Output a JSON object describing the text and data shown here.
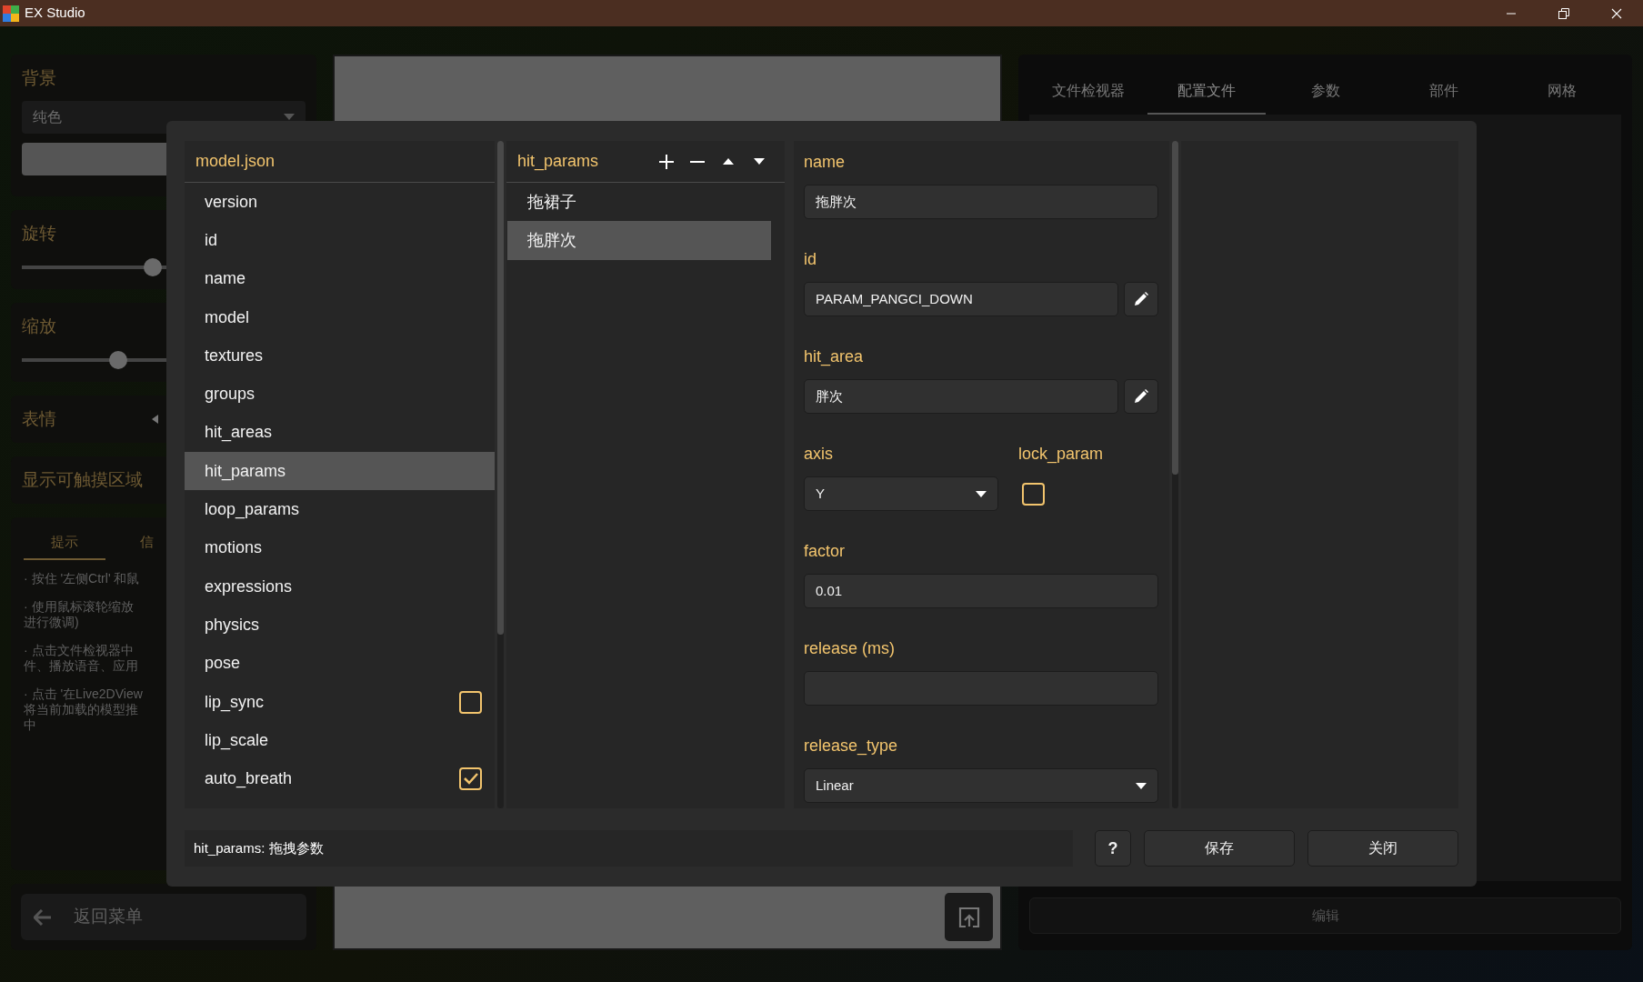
{
  "window": {
    "title": "EX Studio"
  },
  "sidebar": {
    "background": {
      "label": "背景",
      "value": "纯色"
    },
    "rotation": {
      "label": "旋转",
      "level": 0.46
    },
    "scale": {
      "label": "缩放",
      "level": 0.34
    },
    "expressions": {
      "label": "表情",
      "expanded": false
    },
    "touch_areas": {
      "label": "显示可触摸区域"
    },
    "hints": {
      "tabs": [
        {
          "label": "提示",
          "selected": true
        },
        {
          "label": "信",
          "selected": false
        }
      ],
      "items": [
        [
          "· 按住 '左侧Ctrl' 和鼠"
        ],
        [
          "· 使用鼠标滚轮缩放",
          "进行微调)"
        ],
        [
          "· 点击文件检视器中",
          "件、播放语音、应用"
        ],
        [
          "· 点击 '在Live2DView",
          "将当前加载的模型推",
          "中"
        ]
      ]
    },
    "back_button": "返回菜单"
  },
  "right_panel": {
    "tabs": [
      {
        "label": "文件检视器",
        "selected": false
      },
      {
        "label": "配置文件",
        "selected": true
      },
      {
        "label": "参数",
        "selected": false
      },
      {
        "label": "部件",
        "selected": false
      },
      {
        "label": "网格",
        "selected": false
      }
    ],
    "button": "编辑"
  },
  "dialog": {
    "tree": {
      "title": "model.json",
      "items": [
        {
          "label": "version",
          "kind": "item",
          "selected": false
        },
        {
          "label": "id",
          "kind": "item",
          "selected": false
        },
        {
          "label": "name",
          "kind": "item",
          "selected": false
        },
        {
          "label": "model",
          "kind": "item",
          "selected": false
        },
        {
          "label": "textures",
          "kind": "item",
          "selected": false
        },
        {
          "label": "groups",
          "kind": "item",
          "selected": false
        },
        {
          "label": "hit_areas",
          "kind": "item",
          "selected": false
        },
        {
          "label": "hit_params",
          "kind": "item",
          "selected": true
        },
        {
          "label": "loop_params",
          "kind": "item",
          "selected": false
        },
        {
          "label": "motions",
          "kind": "item",
          "selected": false
        },
        {
          "label": "expressions",
          "kind": "item",
          "selected": false
        },
        {
          "label": "physics",
          "kind": "item",
          "selected": false
        },
        {
          "label": "pose",
          "kind": "item",
          "selected": false
        },
        {
          "label": "lip_sync",
          "kind": "checkbox",
          "checked": false,
          "selected": false
        },
        {
          "label": "lip_scale",
          "kind": "item",
          "selected": false
        },
        {
          "label": "auto_breath",
          "kind": "checkbox",
          "checked": true,
          "selected": false
        }
      ]
    },
    "list": {
      "title": "hit_params",
      "items": [
        {
          "label": "拖裙子",
          "selected": false
        },
        {
          "label": "拖胖次",
          "selected": true
        }
      ]
    },
    "form": [
      {
        "kind": "text",
        "label": "name",
        "value": "拖胖次"
      },
      {
        "kind": "text_edit",
        "label": "id",
        "value": "PARAM_PANGCI_DOWN"
      },
      {
        "kind": "text_edit",
        "label": "hit_area",
        "value": "胖次"
      },
      {
        "kind": "pair",
        "fields": [
          {
            "kind": "select",
            "label": "axis",
            "value": "Y"
          },
          {
            "kind": "checkbox",
            "label": "lock_param",
            "checked": false
          }
        ]
      },
      {
        "kind": "text",
        "label": "factor",
        "value": "0.01"
      },
      {
        "kind": "text",
        "label": "release (ms)"
      },
      {
        "kind": "select",
        "label": "release_type",
        "value": "Linear"
      }
    ],
    "status": "hit_params: 拖拽参数",
    "buttons": [
      {
        "kind": "help",
        "label": "?"
      },
      {
        "kind": "normal",
        "label": "保存"
      },
      {
        "kind": "normal",
        "label": "关闭"
      }
    ]
  }
}
